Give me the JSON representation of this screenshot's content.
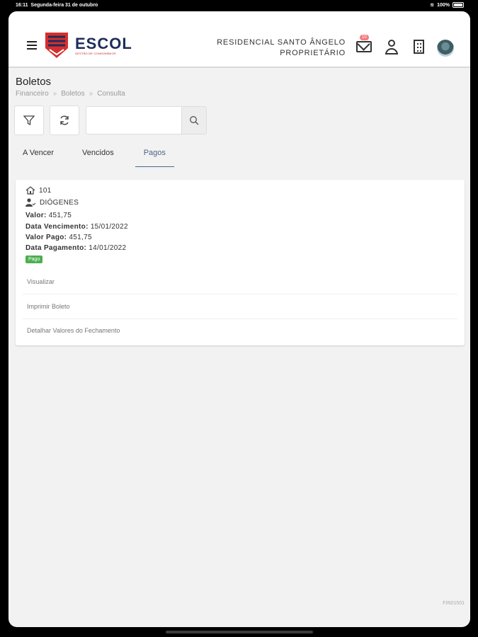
{
  "status_bar": {
    "time": "16:11",
    "date": "Segunda-feira 31 de outubro",
    "battery": "100%"
  },
  "header": {
    "brand": "ESCOL",
    "brand_sub": "GESTÃO DE CONDOMÍNIOS",
    "condo_name": "RESIDENCIAL SANTO ÂNGELO",
    "role": "PROPRIETÁRIO",
    "mail_badge": "10"
  },
  "page": {
    "title": "Boletos",
    "breadcrumb": [
      "Financeiro",
      "Boletos",
      "Consulta"
    ],
    "search_placeholder": ""
  },
  "tabs": [
    {
      "label": "A Vencer"
    },
    {
      "label": "Vencidos"
    },
    {
      "label": "Pagos"
    }
  ],
  "boleto": {
    "unit": "101",
    "owner": "DIÓGENES",
    "valor_label": "Valor:",
    "valor": "451,75",
    "vencimento_label": "Data Vencimento:",
    "vencimento": "15/01/2022",
    "pago_label": "Valor Pago:",
    "pago": "451,75",
    "pagamento_label": "Data Pagamento:",
    "pagamento": "14/01/2022",
    "status": "Pago"
  },
  "actions": [
    "Visualizar",
    "Imprimir Boleto",
    "Detalhar Valores do Fechamento"
  ],
  "footer_code": "FIN01501",
  "colors": {
    "brand": "#1e2c5a",
    "accent": "#4a6688",
    "paid": "#4caf50"
  }
}
